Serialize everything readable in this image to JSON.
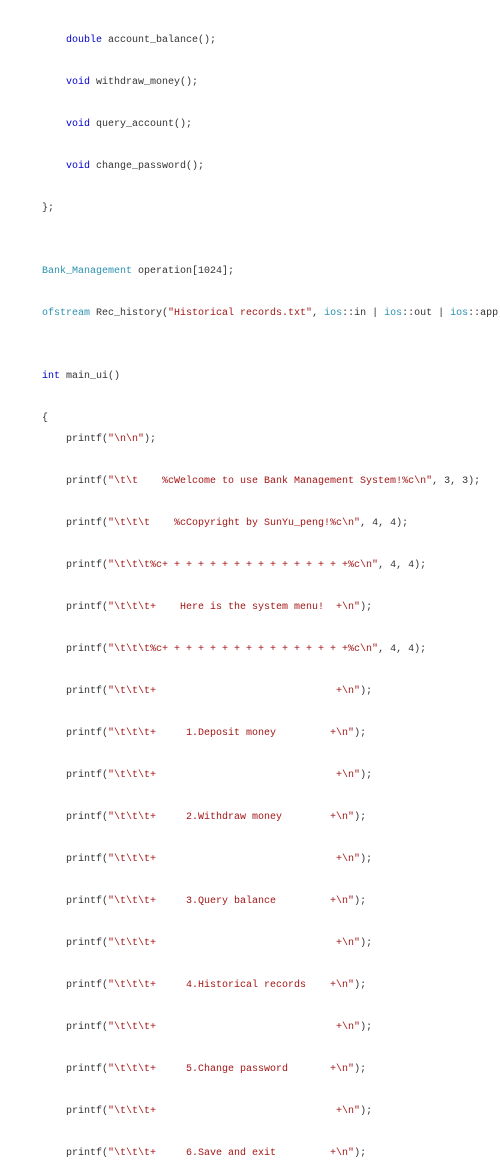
{
  "code": {
    "l01a": "    ",
    "l01b": "double",
    "l01c": " account_balance();",
    "l02": "",
    "l03a": "    ",
    "l03b": "void",
    "l03c": " withdraw_money();",
    "l04": "",
    "l05a": "    ",
    "l05b": "void",
    "l05c": " query_account();",
    "l06": "",
    "l07a": "    ",
    "l07b": "void",
    "l07c": " change_password();",
    "l08": "",
    "l09": "};",
    "l10": "",
    "l11": "",
    "l12a": "Bank_Management",
    "l12b": " operation[",
    "l12c": "1024",
    "l12d": "];",
    "l13": "",
    "l14a": "ofstream",
    "l14b": " Rec_history(",
    "l14c": "\"Historical records.txt\"",
    "l14d": ", ",
    "l14e": "ios",
    "l14f": "::in | ",
    "l14g": "ios",
    "l14h": "::out | ",
    "l14i": "ios",
    "l14j": "::app);",
    "l15": "",
    "l16": "",
    "l17a": "int",
    "l17b": " main_ui()",
    "l18": "",
    "l19": "{",
    "l20a": "    printf(",
    "l20b": "\"\\n\\n\"",
    "l20c": ");",
    "l21": "",
    "l22a": "    printf(",
    "l22b": "\"\\t\\t    %cWelcome to use Bank Management System!%c\\n\"",
    "l22c": ", ",
    "l22d": "3",
    "l22e": ", ",
    "l22f": "3",
    "l22g": ");",
    "l23": "",
    "l24a": "    printf(",
    "l24b": "\"\\t\\t\\t    %cCopyright by SunYu_peng!%c\\n\"",
    "l24c": ", ",
    "l24d": "4",
    "l24e": ", ",
    "l24f": "4",
    "l24g": ");",
    "l25": "",
    "l26a": "    printf(",
    "l26b": "\"\\t\\t\\t%c+ + + + + + + + + + + + + + + +%c\\n\"",
    "l26c": ", ",
    "l26d": "4",
    "l26e": ", ",
    "l26f": "4",
    "l26g": ");",
    "l27": "",
    "l28a": "    printf(",
    "l28b": "\"\\t\\t\\t+    Here is the system menu!  +\\n\"",
    "l28c": ");",
    "l29": "",
    "l30a": "    printf(",
    "l30b": "\"\\t\\t\\t%c+ + + + + + + + + + + + + + + +%c\\n\"",
    "l30c": ", ",
    "l30d": "4",
    "l30e": ", ",
    "l30f": "4",
    "l30g": ");",
    "l31": "",
    "l32a": "    printf(",
    "l32b": "\"\\t\\t\\t+                              +\\n\"",
    "l32c": ");",
    "l33": "",
    "l34a": "    printf(",
    "l34b": "\"\\t\\t\\t+     1.Deposit money         +\\n\"",
    "l34c": ");",
    "l35": "",
    "l36a": "    printf(",
    "l36b": "\"\\t\\t\\t+                              +\\n\"",
    "l36c": ");",
    "l37": "",
    "l38a": "    printf(",
    "l38b": "\"\\t\\t\\t+     2.Withdraw money        +\\n\"",
    "l38c": ");",
    "l39": "",
    "l40a": "    printf(",
    "l40b": "\"\\t\\t\\t+                              +\\n\"",
    "l40c": ");",
    "l41": "",
    "l42a": "    printf(",
    "l42b": "\"\\t\\t\\t+     3.Query balance         +\\n\"",
    "l42c": ");",
    "l43": "",
    "l44a": "    printf(",
    "l44b": "\"\\t\\t\\t+                              +\\n\"",
    "l44c": ");",
    "l45": "",
    "l46a": "    printf(",
    "l46b": "\"\\t\\t\\t+     4.Historical records    +\\n\"",
    "l46c": ");",
    "l47": "",
    "l48a": "    printf(",
    "l48b": "\"\\t\\t\\t+                              +\\n\"",
    "l48c": ");",
    "l49": "",
    "l50a": "    printf(",
    "l50b": "\"\\t\\t\\t+     5.Change password       +\\n\"",
    "l50c": ");",
    "l51": "",
    "l52a": "    printf(",
    "l52b": "\"\\t\\t\\t+                              +\\n\"",
    "l52c": ");",
    "l53": "",
    "l54a": "    printf(",
    "l54b": "\"\\t\\t\\t+     6.Save and exit         +\\n\"",
    "l54c": ");"
  }
}
